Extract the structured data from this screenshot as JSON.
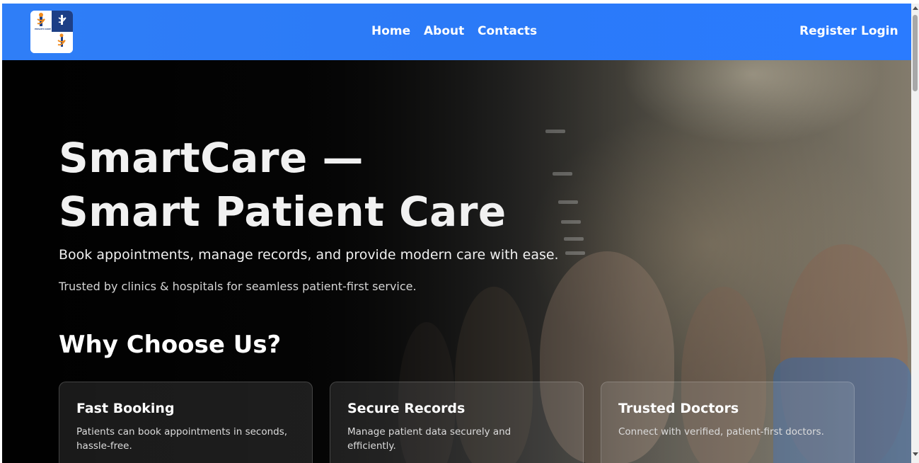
{
  "navbar": {
    "logo_text": "HEALTH CARE",
    "links": [
      "Home",
      "About",
      "Contacts"
    ],
    "register_label": "Register",
    "login_label": "Login"
  },
  "hero": {
    "title": "SmartCare — Smart Patient Care",
    "subtitle": "Book appointments, manage records, and provide modern care with ease.",
    "trust_line": "Trusted by clinics & hospitals for seamless patient-first service.",
    "section_heading": "Why Choose Us?"
  },
  "features": [
    {
      "title": "Fast Booking",
      "description": "Patients can book appointments in seconds, hassle-free."
    },
    {
      "title": "Secure Records",
      "description": "Manage patient data securely and efficiently."
    },
    {
      "title": "Trusted Doctors",
      "description": "Connect with verified, patient-first doctors."
    }
  ],
  "colors": {
    "navbar": "#2b7af7",
    "text": "#ffffff"
  }
}
